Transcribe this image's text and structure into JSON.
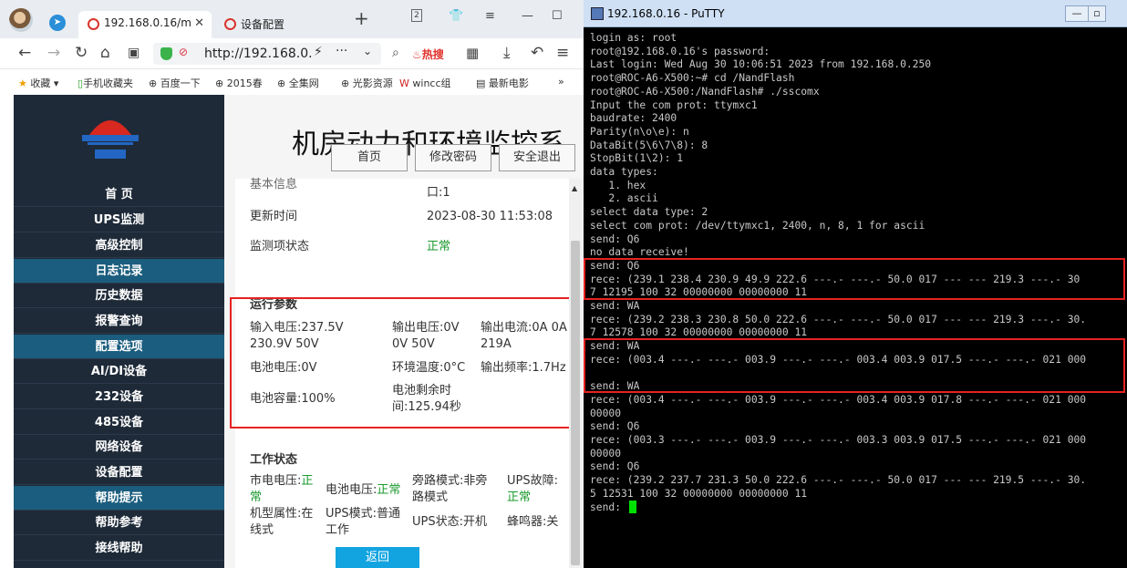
{
  "browser": {
    "tabs": [
      {
        "label": "192.168.0.16/m",
        "active": true
      },
      {
        "label": "设备配置",
        "active": false
      }
    ],
    "tab_count": "2",
    "url": "http://192.168.0.1",
    "hot_label": "热搜",
    "bookmarks": [
      "收藏",
      "手机收藏夹",
      "百度一下",
      "2015春",
      "全集网",
      "光影资源",
      "wincc组",
      "最新电影"
    ]
  },
  "webpage": {
    "title": "机房动力和环境监控系",
    "top_buttons": [
      "首页",
      "修改密码",
      "安全退出"
    ],
    "nav": [
      {
        "label": "首 页",
        "header": false
      },
      {
        "label": "UPS监测",
        "header": false
      },
      {
        "label": "高级控制",
        "header": false
      },
      {
        "label": "日志记录",
        "header": true
      },
      {
        "label": "历史数据",
        "header": false
      },
      {
        "label": "报警查询",
        "header": false
      },
      {
        "label": "配置选项",
        "header": true
      },
      {
        "label": "AI/DI设备",
        "header": false
      },
      {
        "label": "232设备",
        "header": false
      },
      {
        "label": "485设备",
        "header": false
      },
      {
        "label": "网络设备",
        "header": false
      },
      {
        "label": "设备配置",
        "header": false
      },
      {
        "label": "帮助提示",
        "header": true
      },
      {
        "label": "帮助参考",
        "header": false
      },
      {
        "label": "接线帮助",
        "header": false
      }
    ],
    "basic": {
      "section": "基本信息",
      "port": "口:1",
      "update_label": "更新时间",
      "update_value": "2023-08-30 11:53:08",
      "status_label": "监测项状态",
      "status_value": "正常"
    },
    "run": {
      "section": "运行参数",
      "input_voltage": "输入电压:237.5V 230.9V 50V",
      "output_voltage": "输出电压:0V 0V 50V",
      "output_current": "输出电流:0A 0A 219A",
      "battery_voltage": "电池电压:0V",
      "env_temp": "环境温度:0°C",
      "out_freq": "输出频率:1.7Hz",
      "battery_capacity": "电池容量:100%",
      "battery_time": "电池剩余时间:125.94秒"
    },
    "work": {
      "section": "工作状态",
      "mains_label": "市电电压:",
      "mains_value": "正常",
      "battery_label": "电池电压:",
      "battery_value": "正常",
      "bypass": "旁路模式:非旁路模式",
      "fault_label": "UPS故障:",
      "fault_value": "正常",
      "model": "机型属性:在线式",
      "mode": "UPS模式:普通工作",
      "state": "UPS状态:开机",
      "buzzer": "蜂鸣器:关"
    },
    "back_button": "返回"
  },
  "putty": {
    "title": "192.168.0.16 - PuTTY",
    "lines": [
      "login as: root",
      "root@192.168.0.16's password:",
      "Last login: Wed Aug 30 10:06:51 2023 from 192.168.0.250",
      "root@ROC-A6-X500:~# cd /NandFlash",
      "root@ROC-A6-X500:/NandFlash# ./sscomx",
      "Input the com prot: ttymxc1",
      "baudrate: 2400",
      "Parity(n\\o\\e): n",
      "DataBit(5\\6\\7\\8): 8",
      "StopBit(1\\2): 1",
      "data types:",
      "   1. hex",
      "   2. ascii",
      "select data type: 2",
      "select com prot: /dev/ttymxc1, 2400, n, 8, 1 for ascii",
      "send: Q6",
      "no data receive!",
      "send: Q6",
      "rece: (239.1 238.4 230.9 49.9 222.6 ---.- ---.- 50.0 017 --- --- 219.3 ---.- 30",
      "7 12195 100 32 00000000 00000000 11",
      "send: WA",
      "rece: (239.2 238.3 230.8 50.0 222.6 ---.- ---.- 50.0 017 --- --- 219.3 ---.- 30.",
      "7 12578 100 32 00000000 00000000 11",
      "send: WA",
      "rece: (003.4 ---.- ---.- 003.9 ---.- ---.- 003.4 003.9 017.5 ---.- ---.- 021 000",
      "",
      "send: WA",
      "rece: (003.4 ---.- ---.- 003.9 ---.- ---.- 003.4 003.9 017.8 ---.- ---.- 021 000",
      "00000",
      "send: Q6",
      "rece: (003.3 ---.- ---.- 003.9 ---.- ---.- 003.3 003.9 017.5 ---.- ---.- 021 000",
      "00000",
      "send: Q6",
      "rece: (239.2 237.7 231.3 50.0 222.6 ---.- ---.- 50.0 017 --- --- 219.5 ---.- 30.",
      "5 12531 100 32 00000000 00000000 11",
      "send: "
    ]
  }
}
